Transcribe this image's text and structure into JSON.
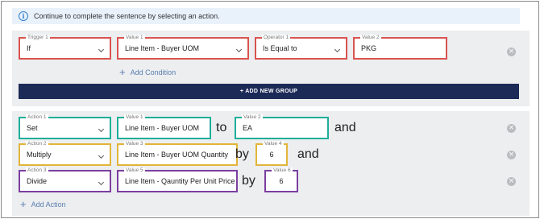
{
  "info": {
    "text": "Continue to complete the sentence by selecting an action.",
    "icon": "info-icon"
  },
  "condition_group": {
    "trigger": {
      "label": "Trigger 1",
      "value": "If"
    },
    "value1": {
      "label": "Value 1",
      "value": "Line Item - Buyer UOM"
    },
    "operator": {
      "label": "Operator 1",
      "value": "Is Equal to"
    },
    "value2": {
      "label": "Value 2",
      "value": "PKG"
    },
    "add_condition": "Add Condition",
    "add_group": "+ ADD NEW GROUP"
  },
  "actions": [
    {
      "action": {
        "label": "Action 1",
        "value": "Set"
      },
      "field": {
        "label": "Value 1",
        "value": "Line Item - Buyer UOM"
      },
      "connector": "to",
      "target": {
        "label": "Value 2",
        "value": "EA"
      },
      "suffix": "and"
    },
    {
      "action": {
        "label": "Action 2",
        "value": "Multiply"
      },
      "field": {
        "label": "Value 3",
        "value": "Line Item - Buyer UOM Quantity"
      },
      "connector": "by",
      "target": {
        "label": "Value 4",
        "value": "6"
      },
      "suffix": "and"
    },
    {
      "action": {
        "label": "Action 3",
        "value": "Divide"
      },
      "field": {
        "label": "Value 5",
        "value": "Line Item - Qauntity Per Unit Price"
      },
      "connector": "by",
      "target": {
        "label": "Value 6",
        "value": "6"
      },
      "suffix": ""
    }
  ],
  "add_action": "Add Action",
  "colors": {
    "condition_border": "#d9534f",
    "action1_border": "#1fae9a",
    "action2_border": "#e2b43a",
    "action3_border": "#7b3fa0",
    "group_button": "#1c2a57"
  }
}
